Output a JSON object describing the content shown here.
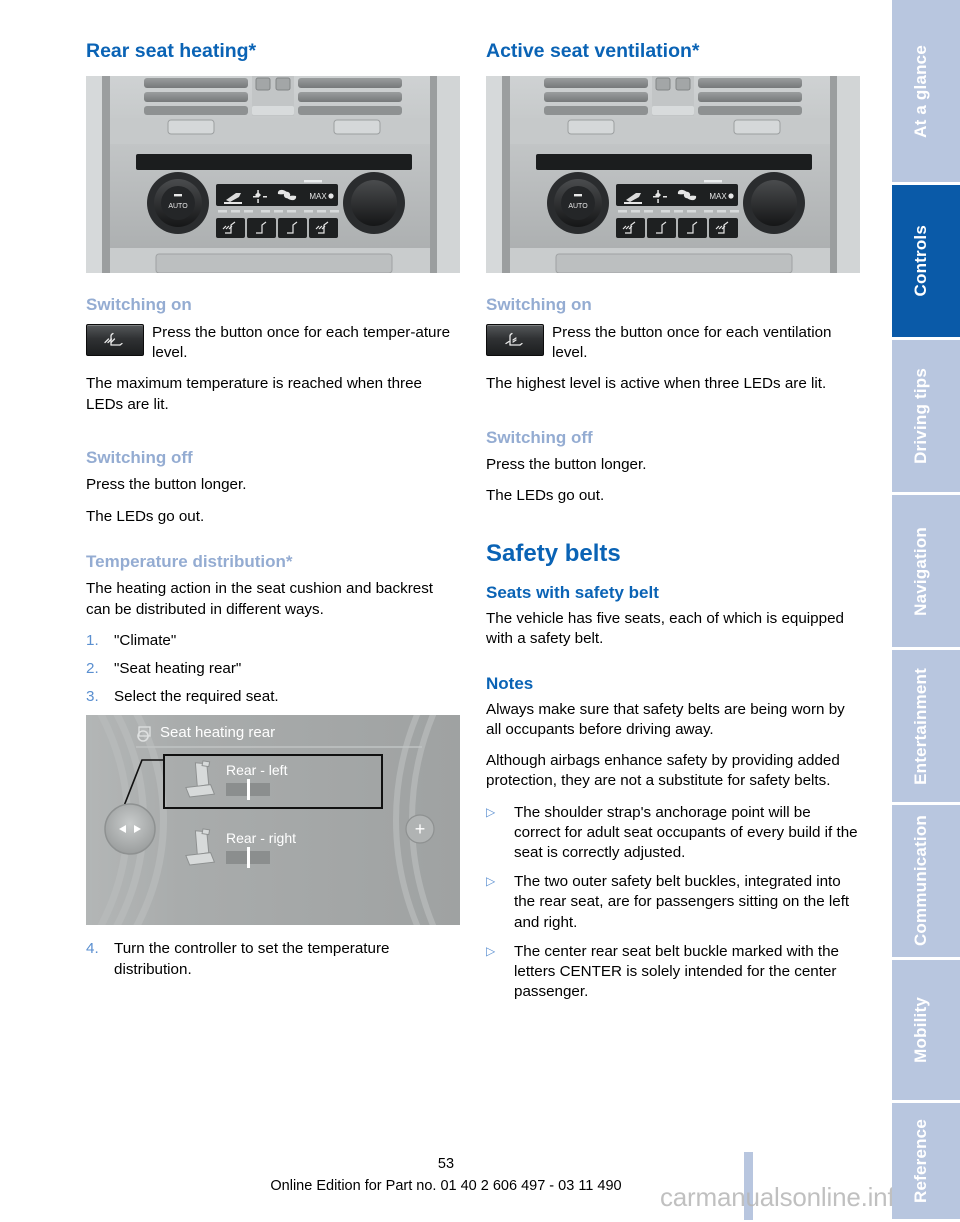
{
  "document": {
    "page_number": "53",
    "footer_text": "Online Edition for Part no. 01 40 2 606 497 - 03 11 490",
    "watermark": "carmanualsonline.info"
  },
  "colors": {
    "heading_blue": "#0a63b5",
    "subheading_blue": "#94acd2",
    "active_tab_blue": "#0a5aa8",
    "tab_blue": "#b8c6df",
    "list_number_blue": "#5a8fd0"
  },
  "tabs": [
    {
      "label": "At a glance",
      "active": false
    },
    {
      "label": "Controls",
      "active": true
    },
    {
      "label": "Driving tips",
      "active": false
    },
    {
      "label": "Navigation",
      "active": false
    },
    {
      "label": "Entertainment",
      "active": false
    },
    {
      "label": "Communication",
      "active": false
    },
    {
      "label": "Mobility",
      "active": false
    },
    {
      "label": "Reference",
      "active": false
    }
  ],
  "left_column": {
    "title": "Rear seat heating*",
    "photo_caption": "rear-climate-control-panel",
    "switching_on": {
      "heading": "Switching on",
      "icon_text": "Press the button once for each temper-­ature level.",
      "paragraph": "The maximum temperature is reached when three LEDs are lit."
    },
    "switching_off": {
      "heading": "Switching off",
      "line1": "Press the button longer.",
      "line2": "The LEDs go out."
    },
    "temperature_distribution": {
      "heading": "Temperature distribution*",
      "intro": "The heating action in the seat cushion and back­rest can be distributed in different ways.",
      "steps": [
        {
          "num": "1.",
          "text": "\"Climate\""
        },
        {
          "num": "2.",
          "text": "\"Seat heating rear\""
        },
        {
          "num": "3.",
          "text": "Select the required seat."
        }
      ],
      "final_step": {
        "num": "4.",
        "text": "Turn the controller to set the temperature distribution."
      }
    },
    "idrive_screen": {
      "menu_title": "Seat heating rear",
      "row1_label": "Rear - left",
      "row2_label": "Rear - right",
      "plus_symbol": "+"
    }
  },
  "right_column": {
    "title": "Active seat ventilation*",
    "photo_caption": "rear-climate-control-panel",
    "switching_on": {
      "heading": "Switching on",
      "icon_text": "Press the button once for each ventila­tion level.",
      "paragraph": "The highest level is active when three LEDs are lit."
    },
    "switching_off": {
      "heading": "Switching off",
      "line1": "Press the button longer.",
      "line2": "The LEDs go out."
    },
    "safety_belts": {
      "title": "Safety belts",
      "seats_heading": "Seats with safety belt",
      "seats_text": "The vehicle has five seats, each of which is equipped with a safety belt.",
      "notes_heading": "Notes",
      "note1": "Always make sure that safety belts are being worn by all occupants before driving away.",
      "note2": "Although airbags enhance safety by providing added protection, they are not a substitute for safety belts.",
      "bullets": [
        "The shoulder strap's anchorage point will be correct for adult seat occupants of every build if the seat is correctly adjusted.",
        "The two outer safety belt buckles, integrated into the rear seat, are for passen­gers sitting on the left and right.",
        "The center rear seat belt buckle marked with the letters CENTER is solely intended for the center passenger."
      ]
    }
  }
}
